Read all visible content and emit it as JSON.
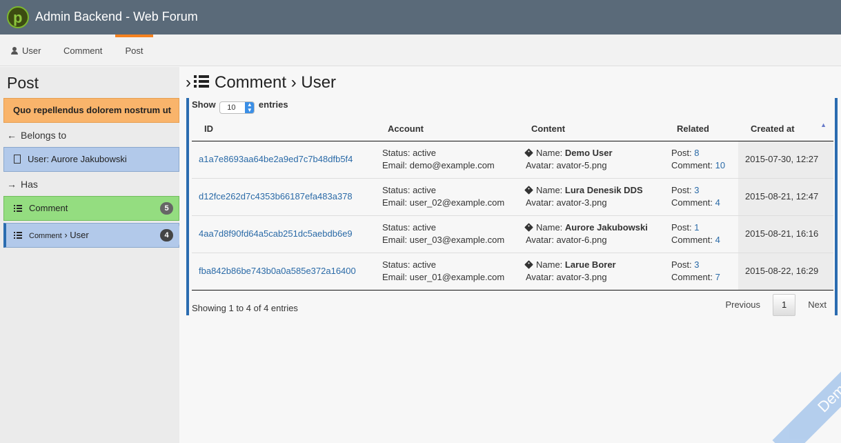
{
  "app": {
    "title": "Admin Backend - Web Forum",
    "logo_letter": "p"
  },
  "nav": {
    "items": [
      {
        "label": "User"
      },
      {
        "label": "Comment"
      },
      {
        "label": "Post"
      }
    ]
  },
  "sidebar": {
    "title": "Post",
    "post_title": "Quo repellendus dolorem nostrum ut",
    "belongs_to_label": "Belongs to",
    "belongs_to_item": "User: Aurore Jakubowski",
    "has_label": "Has",
    "has_items": [
      {
        "label": "Comment",
        "count": "5"
      },
      {
        "label_prefix": "Comment",
        "label_sep": "›",
        "label_suffix": "User",
        "count": "4"
      }
    ]
  },
  "main": {
    "title_prefix": "›",
    "title_part1": "Comment",
    "title_sep": "›",
    "title_part2": "User",
    "show_label": "Show",
    "entries_label": "entries",
    "page_length": "10",
    "columns": [
      "ID",
      "Account",
      "Content",
      "Related",
      "Created at"
    ],
    "rows": [
      {
        "id": "a1a7e8693aa64be2a9ed7c7b48dfb5f4",
        "status": "Status: active",
        "email": "Email: demo@example.com",
        "name_label": "Name:",
        "name": "Demo User",
        "avatar": "Avatar: avator-5.png",
        "post_label": "Post:",
        "post_count": "8",
        "comment_label": "Comment:",
        "comment_count": "10",
        "created": "2015-07-30, 12:27"
      },
      {
        "id": "d12fce262d7c4353b66187efa483a378",
        "status": "Status: active",
        "email": "Email: user_02@example.com",
        "name_label": "Name:",
        "name": "Lura Denesik DDS",
        "avatar": "Avatar: avator-3.png",
        "post_label": "Post:",
        "post_count": "3",
        "comment_label": "Comment:",
        "comment_count": "4",
        "created": "2015-08-21, 12:47"
      },
      {
        "id": "4aa7d8f90fd64a5cab251dc5aebdb6e9",
        "status": "Status: active",
        "email": "Email: user_03@example.com",
        "name_label": "Name:",
        "name": "Aurore Jakubowski",
        "avatar": "Avatar: avator-6.png",
        "post_label": "Post:",
        "post_count": "1",
        "comment_label": "Comment:",
        "comment_count": "4",
        "created": "2015-08-21, 16:16"
      },
      {
        "id": "fba842b86be743b0a0a585e372a16400",
        "status": "Status: active",
        "email": "Email: user_01@example.com",
        "name_label": "Name:",
        "name": "Larue Borer",
        "avatar": "Avatar: avator-3.png",
        "post_label": "Post:",
        "post_count": "3",
        "comment_label": "Comment:",
        "comment_count": "7",
        "created": "2015-08-22, 16:29"
      }
    ],
    "info": "Showing 1 to 4 of 4 entries",
    "pager": {
      "previous": "Previous",
      "current": "1",
      "next": "Next"
    }
  },
  "ribbon": "Demo",
  "colors": {
    "topbar": "#5a6a79",
    "accent": "#f58220",
    "link": "#2a6aa7",
    "panel_border": "#2b6cb0"
  }
}
